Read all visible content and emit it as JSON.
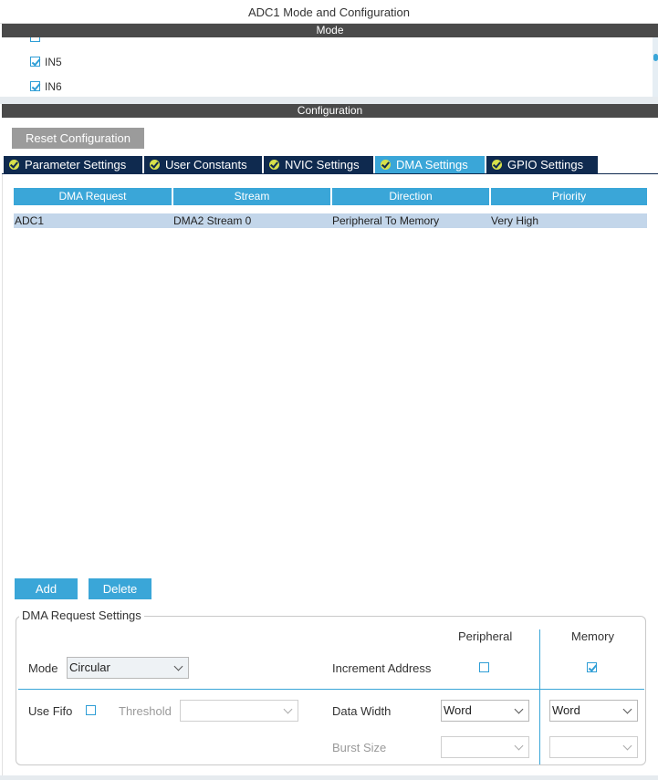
{
  "window": {
    "title": "ADC1 Mode and Configuration"
  },
  "mode": {
    "header": "Mode",
    "channels": [
      {
        "label": "IN5",
        "checked": true
      },
      {
        "label": "IN6",
        "checked": true
      }
    ]
  },
  "config": {
    "header": "Configuration",
    "reset_label": "Reset Configuration",
    "tabs": [
      {
        "label": "Parameter Settings",
        "active": false
      },
      {
        "label": "User Constants",
        "active": false
      },
      {
        "label": "NVIC Settings",
        "active": false
      },
      {
        "label": "DMA Settings",
        "active": true
      },
      {
        "label": "GPIO Settings",
        "active": false
      }
    ]
  },
  "dma_table": {
    "columns": [
      "DMA Request",
      "Stream",
      "Direction",
      "Priority"
    ],
    "rows": [
      [
        "ADC1",
        "DMA2 Stream 0",
        "Peripheral To Memory",
        "Very High"
      ]
    ]
  },
  "actions": {
    "add_label": "Add",
    "delete_label": "Delete"
  },
  "request_settings": {
    "title": "DMA Request Settings",
    "peripheral_header": "Peripheral",
    "memory_header": "Memory",
    "mode_label": "Mode",
    "mode_value": "Circular",
    "increment_label": "Increment Address",
    "increment_peripheral": false,
    "increment_memory": true,
    "use_fifo_label": "Use Fifo",
    "use_fifo": false,
    "threshold_label": "Threshold",
    "threshold_value": "",
    "data_width_label": "Data Width",
    "data_width_peripheral": "Word",
    "data_width_memory": "Word",
    "burst_size_label": "Burst Size",
    "burst_peripheral": "",
    "burst_memory": ""
  },
  "colors": {
    "accent": "#3aa6d8",
    "tab_bg": "#0f2a4f",
    "section_bar": "#4a4a4a",
    "row_highlight": "#c3d6ea",
    "check_badge": "#d7e04a"
  }
}
